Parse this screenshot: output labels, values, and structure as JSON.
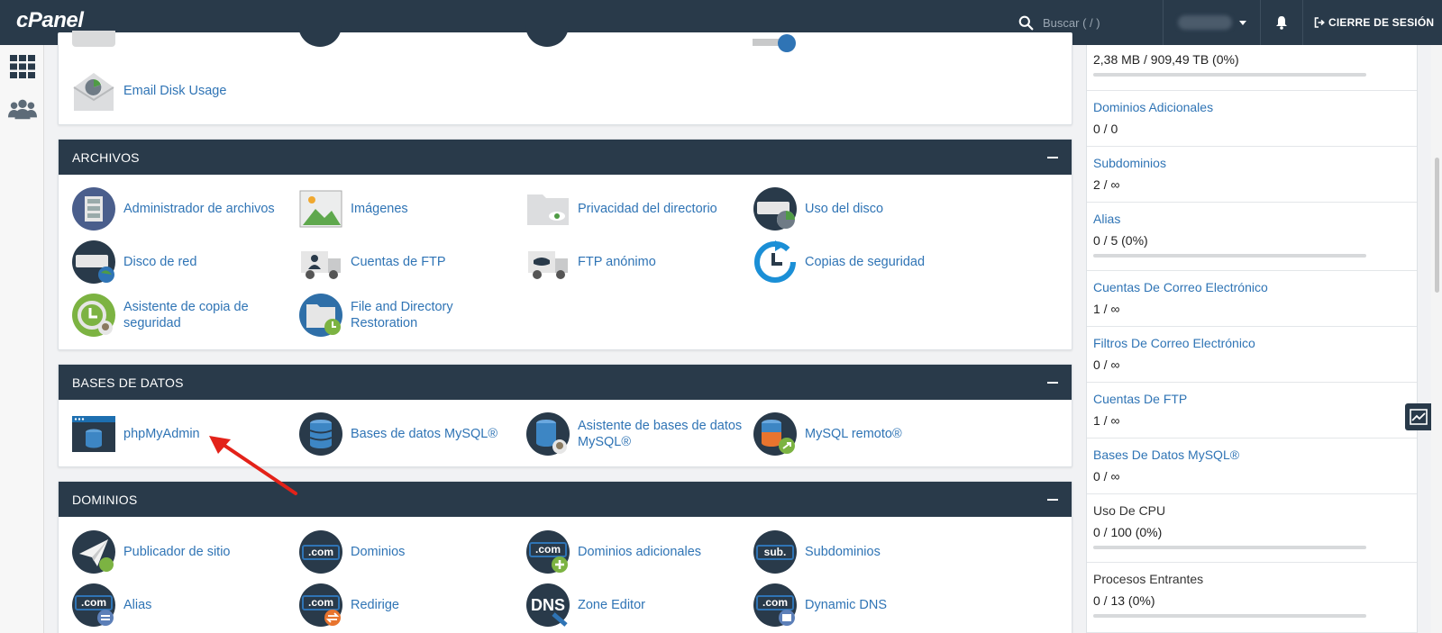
{
  "topbar": {
    "logo": "cPanel",
    "search_placeholder": "Buscar ( / )",
    "logout_label": "CIERRE DE SESIÓN"
  },
  "email_panel": {
    "items": [
      {
        "label": "Email Disk Usage",
        "icon": "email-disk-usage-icon"
      }
    ]
  },
  "archivos": {
    "title": "ARCHIVOS",
    "items": [
      {
        "label": "Administrador de archivos",
        "icon": "file-manager-icon"
      },
      {
        "label": "Imágenes",
        "icon": "images-icon"
      },
      {
        "label": "Privacidad del directorio",
        "icon": "directory-privacy-icon"
      },
      {
        "label": "Uso del disco",
        "icon": "disk-usage-icon"
      },
      {
        "label": "Disco de red",
        "icon": "network-disk-icon"
      },
      {
        "label": "Cuentas de FTP",
        "icon": "ftp-accounts-icon"
      },
      {
        "label": "FTP anónimo",
        "icon": "anonymous-ftp-icon"
      },
      {
        "label": "Copias de seguridad",
        "icon": "backup-icon"
      },
      {
        "label": "Asistente de copia de seguridad",
        "icon": "backup-wizard-icon"
      },
      {
        "label": "File and Directory Restoration",
        "icon": "file-restoration-icon"
      }
    ]
  },
  "bases": {
    "title": "BASES DE DATOS",
    "items": [
      {
        "label": "phpMyAdmin",
        "icon": "phpmyadmin-icon"
      },
      {
        "label": "Bases de datos MySQL®",
        "icon": "mysql-databases-icon"
      },
      {
        "label": "Asistente de bases de datos MySQL®",
        "icon": "mysql-wizard-icon"
      },
      {
        "label": "MySQL remoto®",
        "icon": "remote-mysql-icon"
      }
    ]
  },
  "dominios": {
    "title": "DOMINIOS",
    "items": [
      {
        "label": "Publicador de sitio",
        "icon": "site-publisher-icon"
      },
      {
        "label": "Dominios",
        "icon": "domains-icon",
        "badge": ".com"
      },
      {
        "label": "Dominios adicionales",
        "icon": "addon-domains-icon",
        "badge": ".com"
      },
      {
        "label": "Subdominios",
        "icon": "subdomains-icon",
        "badge": "sub."
      },
      {
        "label": "Alias",
        "icon": "alias-icon",
        "badge": ".com"
      },
      {
        "label": "Redirige",
        "icon": "redirects-icon",
        "badge": ".com"
      },
      {
        "label": "Zone Editor",
        "icon": "zone-editor-icon",
        "badge": "DNS"
      },
      {
        "label": "Dynamic DNS",
        "icon": "dynamic-dns-icon",
        "badge": ".com"
      }
    ]
  },
  "stats": [
    {
      "title": "",
      "value": "2,38 MB / 909,49 TB   (0%)",
      "bar": 0
    },
    {
      "title": "Dominios Adicionales",
      "value": "0 / 0"
    },
    {
      "title": "Subdominios",
      "value": "2 / ∞"
    },
    {
      "title": "Alias",
      "value": "0 / 5   (0%)",
      "bar": 0
    },
    {
      "title": "Cuentas De Correo Electrónico",
      "value": "1 / ∞"
    },
    {
      "title": "Filtros De Correo Electrónico",
      "value": "0 / ∞"
    },
    {
      "title": "Cuentas De FTP",
      "value": "1 / ∞"
    },
    {
      "title": "Bases De Datos MySQL®",
      "value": "0 / ∞"
    },
    {
      "title": "Uso De CPU",
      "value": "0 / 100   (0%)",
      "bar": 0
    },
    {
      "title": "Procesos Entrantes",
      "value": "0 / 13   (0%)",
      "bar": 0
    }
  ],
  "colors": {
    "header": "#293a4a",
    "link": "#2f74b5",
    "arrow": "#e32219"
  }
}
